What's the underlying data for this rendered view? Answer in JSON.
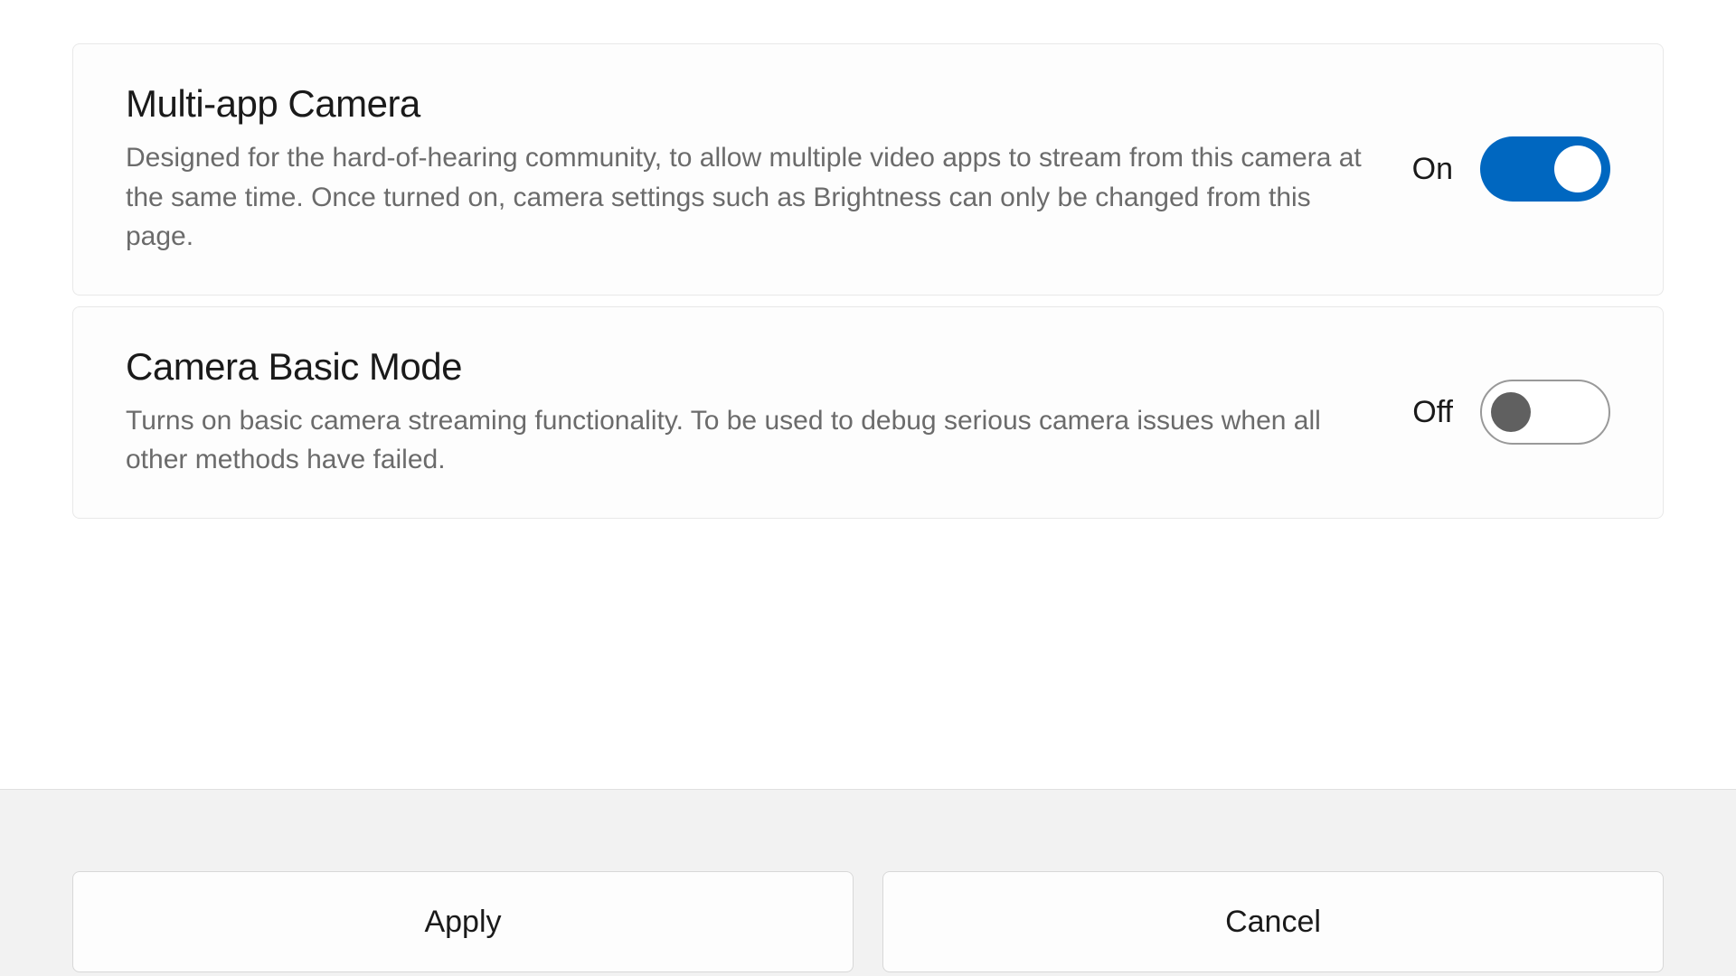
{
  "settings": [
    {
      "title": "Multi-app Camera",
      "description": "Designed for the hard-of-hearing community, to allow multiple video apps to stream from this camera at the same time. Once turned on, camera settings such as Brightness can only be changed from this page.",
      "state_label": "On",
      "enabled": true
    },
    {
      "title": "Camera Basic Mode",
      "description": "Turns on basic camera streaming functionality. To be used to debug serious camera issues when all other methods have failed.",
      "state_label": "Off",
      "enabled": false
    }
  ],
  "footer": {
    "apply_label": "Apply",
    "cancel_label": "Cancel"
  },
  "colors": {
    "accent": "#0067c0",
    "text_primary": "#1a1a1a",
    "text_secondary": "#6b6b6b",
    "footer_bg": "#f2f2f2"
  }
}
